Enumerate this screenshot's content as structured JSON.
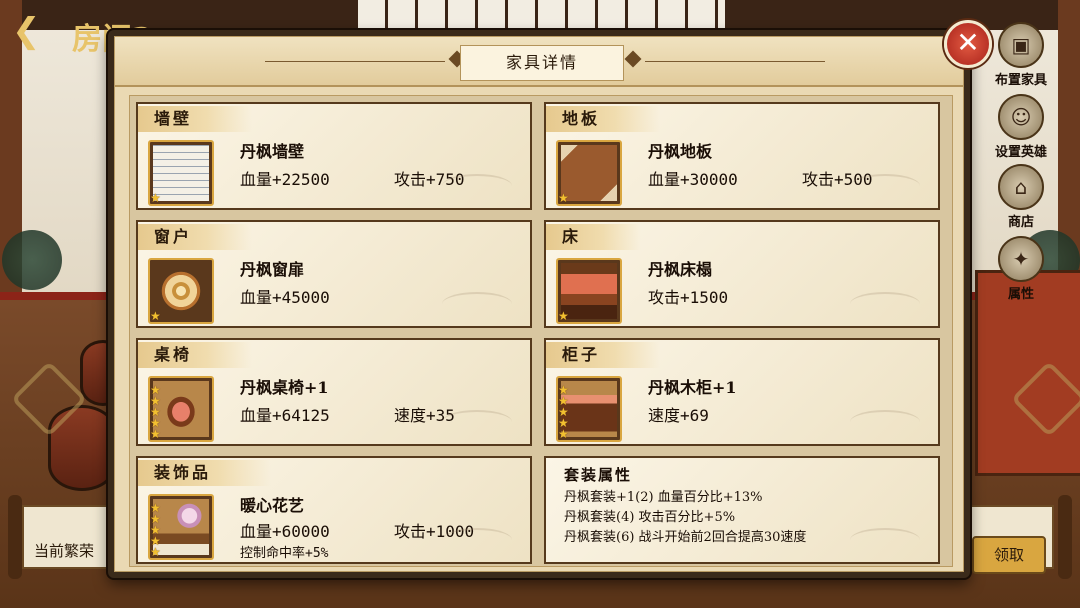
{
  "scene": {
    "room_title": "房间2",
    "bottom_text": "当前繁荣",
    "claim_label": "领取"
  },
  "side_menu": [
    {
      "label": "布置家具",
      "icon": "table-icon"
    },
    {
      "label": "设置英雄",
      "icon": "hero-icon"
    },
    {
      "label": "商店",
      "icon": "shop-icon"
    },
    {
      "label": "属性",
      "icon": "attribute-icon"
    }
  ],
  "dialog": {
    "title": "家具详情",
    "close_icon": "close-icon"
  },
  "cards": [
    {
      "category": "墙壁",
      "name": "丹枫墙壁",
      "stars": 1,
      "icon": "wall-icon",
      "stat1": "血量+22500",
      "stat2": "攻击+750",
      "extra": ""
    },
    {
      "category": "地板",
      "name": "丹枫地板",
      "stars": 1,
      "icon": "floor-icon",
      "stat1": "血量+30000",
      "stat2": "攻击+500",
      "extra": ""
    },
    {
      "category": "窗户",
      "name": "丹枫窗扉",
      "stars": 1,
      "icon": "window-icon",
      "stat1": "血量+45000",
      "stat2": "",
      "extra": ""
    },
    {
      "category": "床",
      "name": "丹枫床榻",
      "stars": 1,
      "icon": "bed-icon",
      "stat1": "攻击+1500",
      "stat2": "",
      "extra": ""
    },
    {
      "category": "桌椅",
      "name": "丹枫桌椅+1",
      "stars": 5,
      "icon": "table-chair-icon",
      "stat1": "血量+64125",
      "stat2": "速度+35",
      "extra": ""
    },
    {
      "category": "柜子",
      "name": "丹枫木柜+1",
      "stars": 5,
      "icon": "cabinet-icon",
      "stat1": "速度+69",
      "stat2": "",
      "extra": ""
    },
    {
      "category": "装饰品",
      "name": "暖心花艺",
      "stars": 5,
      "icon": "flower-decor-icon",
      "stat1": "血量+60000",
      "stat2": "攻击+1000",
      "extra": "控制命中率+5%"
    }
  ],
  "set_bonus": {
    "title": "套装属性",
    "lines": [
      "丹枫套装+1(2) 血量百分比+13%",
      "丹枫套装(4) 攻击百分比+5%",
      "丹枫套装(6) 战斗开始前2回合提高30速度"
    ]
  },
  "colors": {
    "accent_gold": "#d9a640",
    "close_red": "#c8342a",
    "card_border": "#55391c",
    "star": "#f2c030"
  }
}
